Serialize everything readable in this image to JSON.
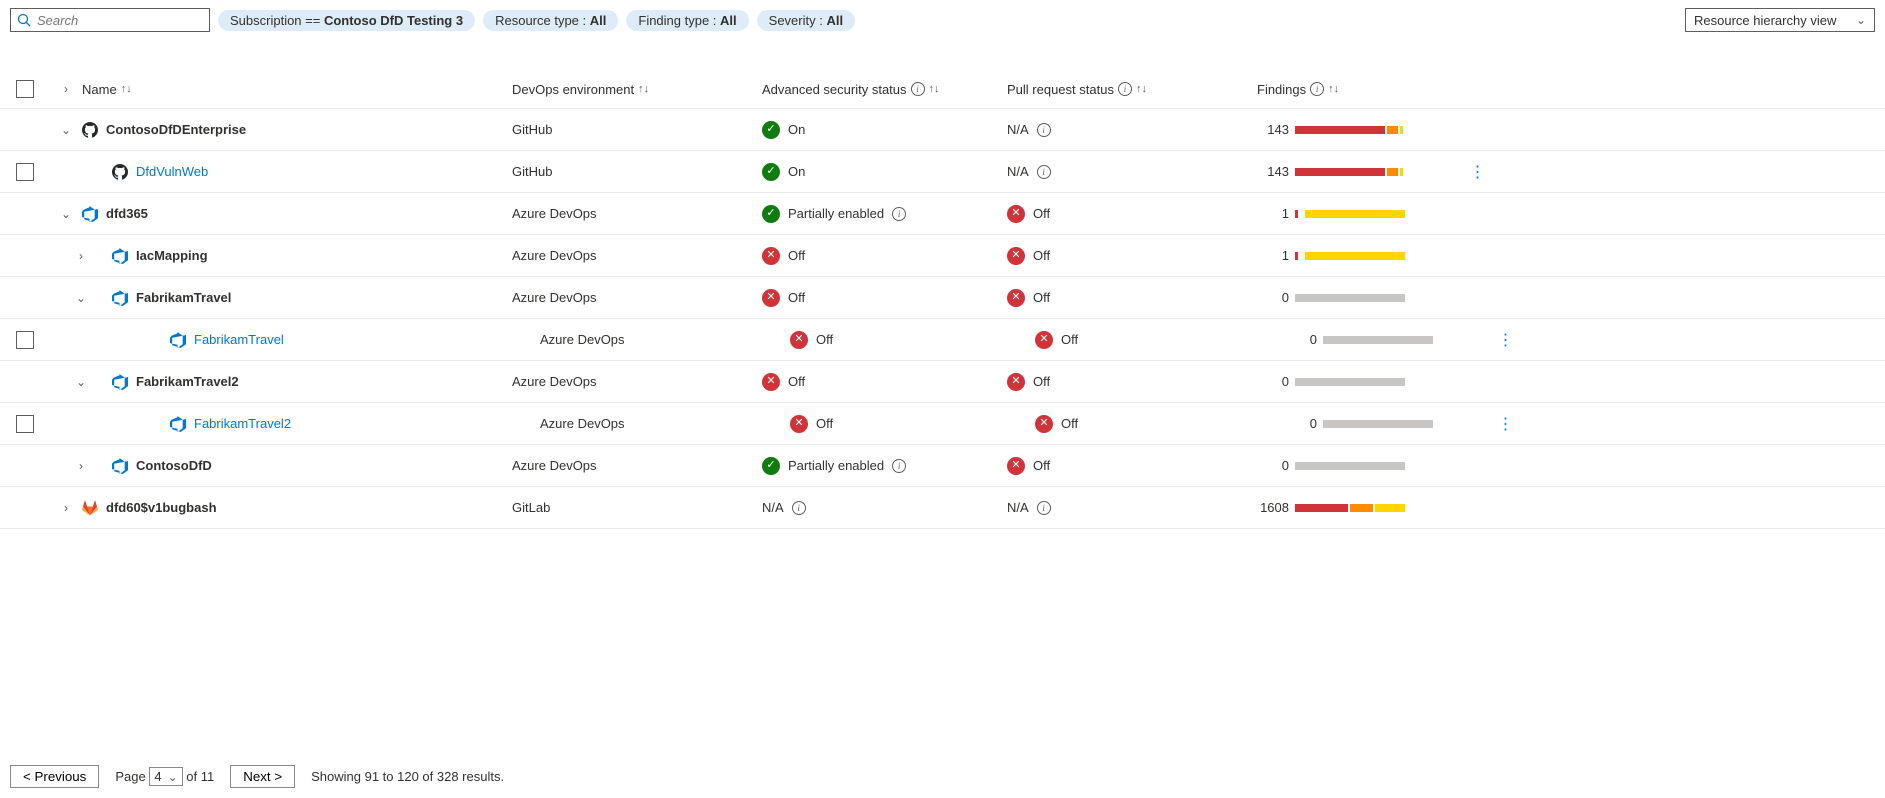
{
  "search": {
    "placeholder": "Search"
  },
  "filters": {
    "subscription": {
      "label": "Subscription == ",
      "value": "Contoso DfD Testing 3"
    },
    "resource_type": {
      "label": "Resource type : ",
      "value": "All"
    },
    "finding_type": {
      "label": "Finding type : ",
      "value": "All"
    },
    "severity": {
      "label": "Severity : ",
      "value": "All"
    }
  },
  "view_dropdown": "Resource hierarchy view",
  "columns": {
    "name": "Name",
    "env": "DevOps environment",
    "adv": "Advanced security status",
    "pr": "Pull request status",
    "find": "Findings"
  },
  "rows": [
    {
      "indent": 0,
      "chev": "down",
      "icon": "github",
      "name": "ContosoDfDEnterprise",
      "link": false,
      "checkbox": false,
      "env": "GitHub",
      "adv": "On",
      "adv_info": false,
      "adv_style": "on",
      "pr": "N/A",
      "pr_style": "na",
      "pr_info": true,
      "findings": "143",
      "bar": "red-orange",
      "actions": false
    },
    {
      "indent": 1,
      "chev": "none",
      "icon": "github",
      "name": "DfdVulnWeb",
      "link": true,
      "checkbox": true,
      "env": "GitHub",
      "adv": "On",
      "adv_info": false,
      "adv_style": "on",
      "pr": "N/A",
      "pr_style": "na",
      "pr_info": true,
      "findings": "143",
      "bar": "red-orange",
      "actions": true
    },
    {
      "indent": 0,
      "chev": "down",
      "icon": "ado",
      "name": "dfd365",
      "link": false,
      "checkbox": false,
      "env": "Azure DevOps",
      "adv": "Partially enabled",
      "adv_info": true,
      "adv_style": "on",
      "pr": "Off",
      "pr_style": "off",
      "pr_info": false,
      "findings": "1",
      "bar": "tick-yellow",
      "actions": false
    },
    {
      "indent": 1,
      "chev": "right",
      "icon": "ado",
      "name": "IacMapping",
      "link": false,
      "checkbox": false,
      "env": "Azure DevOps",
      "adv": "Off",
      "adv_info": false,
      "adv_style": "off",
      "pr": "Off",
      "pr_style": "off",
      "pr_info": false,
      "findings": "1",
      "bar": "tick-yellow",
      "actions": false
    },
    {
      "indent": 1,
      "chev": "down",
      "icon": "ado",
      "name": "FabrikamTravel",
      "link": false,
      "checkbox": false,
      "env": "Azure DevOps",
      "adv": "Off",
      "adv_info": false,
      "adv_style": "off",
      "pr": "Off",
      "pr_style": "off",
      "pr_info": false,
      "findings": "0",
      "bar": "gray",
      "actions": false
    },
    {
      "indent": 2,
      "chev": "none",
      "icon": "ado",
      "name": "FabrikamTravel",
      "link": true,
      "checkbox": true,
      "env": "Azure DevOps",
      "adv": "Off",
      "adv_info": false,
      "adv_style": "off",
      "pr": "Off",
      "pr_style": "off",
      "pr_info": false,
      "findings": "0",
      "bar": "gray",
      "actions": true
    },
    {
      "indent": 1,
      "chev": "down",
      "icon": "ado",
      "name": "FabrikamTravel2",
      "link": false,
      "checkbox": false,
      "env": "Azure DevOps",
      "adv": "Off",
      "adv_info": false,
      "adv_style": "off",
      "pr": "Off",
      "pr_style": "off",
      "pr_info": false,
      "findings": "0",
      "bar": "gray",
      "actions": false
    },
    {
      "indent": 2,
      "chev": "none",
      "icon": "ado",
      "name": "FabrikamTravel2",
      "link": true,
      "checkbox": true,
      "env": "Azure DevOps",
      "adv": "Off",
      "adv_info": false,
      "adv_style": "off",
      "pr": "Off",
      "pr_style": "off",
      "pr_info": false,
      "findings": "0",
      "bar": "gray",
      "actions": true
    },
    {
      "indent": 1,
      "chev": "right",
      "icon": "ado",
      "name": "ContosoDfD",
      "link": false,
      "checkbox": false,
      "env": "Azure DevOps",
      "adv": "Partially enabled",
      "adv_info": true,
      "adv_style": "on",
      "pr": "Off",
      "pr_style": "off",
      "pr_info": false,
      "findings": "0",
      "bar": "gray",
      "actions": false
    },
    {
      "indent": 0,
      "chev": "right",
      "icon": "gitlab",
      "name": "dfd60$v1bugbash",
      "link": false,
      "checkbox": false,
      "env": "GitLab",
      "adv": "N/A",
      "adv_info": true,
      "adv_style": "na",
      "pr": "N/A",
      "pr_style": "na",
      "pr_info": true,
      "findings": "1608",
      "bar": "red-oy",
      "actions": false
    }
  ],
  "footer": {
    "prev": "< Previous",
    "page_label": "Page",
    "page_value": "4",
    "of_total": "of 11",
    "next": "Next >",
    "showing": "Showing 91 to 120 of 328 results."
  }
}
